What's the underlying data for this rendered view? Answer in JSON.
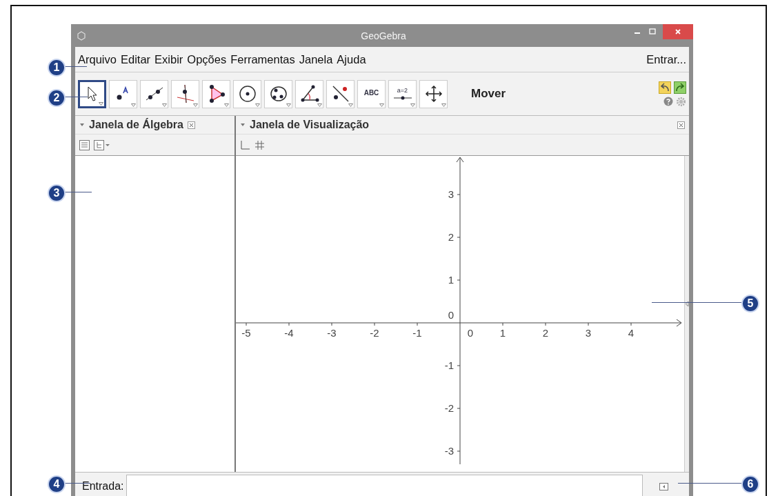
{
  "window": {
    "title": "GeoGebra"
  },
  "menu": [
    "Arquivo",
    "Editar",
    "Exibir",
    "Opções",
    "Ferramentas",
    "Janela",
    "Ajuda"
  ],
  "login": "Entrar...",
  "tools": [
    {
      "kind": "pointer",
      "selected": true
    },
    {
      "kind": "point",
      "selected": false
    },
    {
      "kind": "line",
      "selected": false
    },
    {
      "kind": "perpendicular",
      "selected": false
    },
    {
      "kind": "polygon",
      "selected": false
    },
    {
      "kind": "circle",
      "selected": false
    },
    {
      "kind": "conic",
      "selected": false
    },
    {
      "kind": "angle",
      "selected": false
    },
    {
      "kind": "reflect",
      "selected": false
    },
    {
      "kind": "text",
      "label": "ABC",
      "selected": false
    },
    {
      "kind": "slider",
      "label": "a=2",
      "selected": false
    },
    {
      "kind": "move-view",
      "selected": false
    }
  ],
  "tool_name": "Mover",
  "algebra": {
    "title": "Janela de Álgebra"
  },
  "graphics": {
    "title": "Janela de Visualização",
    "x_labels": [
      "-5",
      "-4",
      "-3",
      "-2",
      "-1",
      "0",
      "1",
      "2",
      "3",
      "4"
    ],
    "y_labels": [
      "3",
      "2",
      "1",
      "0",
      "-1",
      "-2",
      "-3"
    ]
  },
  "input": {
    "label": "Entrada:"
  },
  "callouts": [
    "1",
    "2",
    "3",
    "4",
    "5",
    "6"
  ]
}
